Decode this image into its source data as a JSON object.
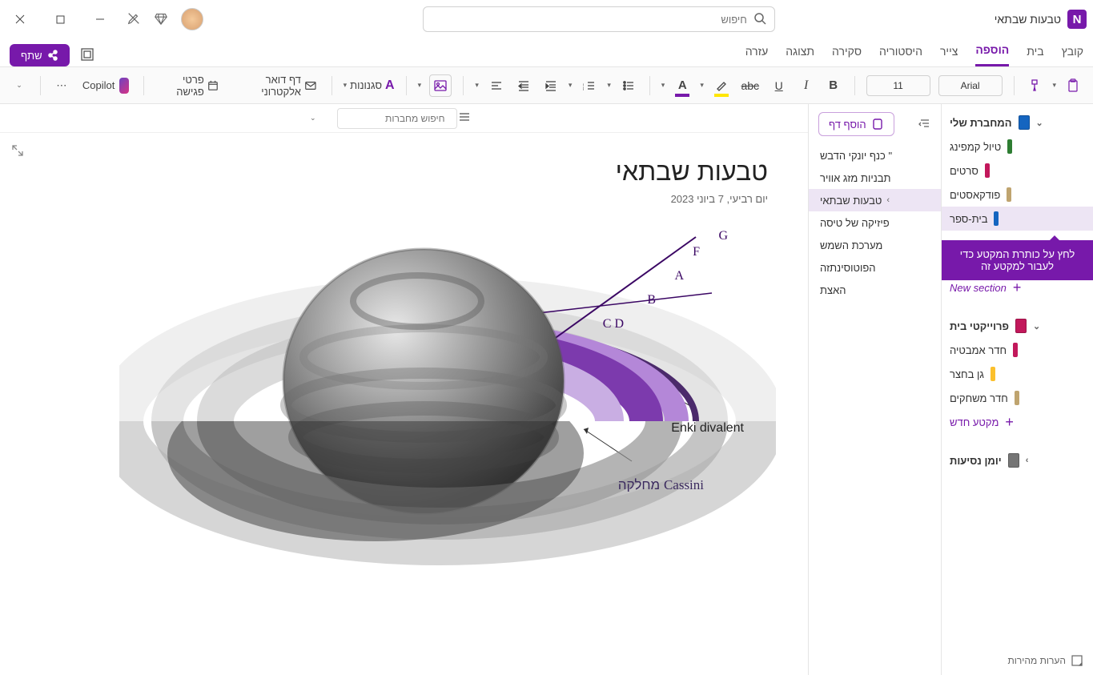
{
  "titlebar": {
    "doc_title": "טבעות שבתאי",
    "search_placeholder": "חיפוש"
  },
  "tabs": {
    "file": "קובץ",
    "home": "בית",
    "insert": "הוספה",
    "draw": "צייר",
    "history": "היסטוריה",
    "review": "סקירה",
    "view": "תצוגה",
    "help": "עזרה",
    "share": "שתף"
  },
  "ribbon": {
    "font_name": "Arial",
    "font_size": "11",
    "styles": "סגנונות",
    "email_page": "דף דואר אלקטרוני",
    "meeting": "פרטי פגישה",
    "copilot": "Copilot"
  },
  "notebooks": {
    "search_placeholder": "חיפוש מחברות",
    "my_notebook": "המחברת שלי",
    "sections1": [
      "טיול קמפינג",
      "סרטים",
      "פודקאסטים",
      "בית-ספר"
    ],
    "new_section": "New section",
    "proj_header": "פרוייקטי בית",
    "sections2": [
      "חדר אמבטיה",
      "גן בחצר",
      "חדר משחקים"
    ],
    "new_section2": "מקטע חדש",
    "travel": "יומן נסיעות",
    "tooltip": "לחץ על כותרת המקטע כדי לעבור למקטע זה",
    "colors": {
      "s1": "#2e7d32",
      "s2": "#c2185b",
      "s3": "#bfa46f",
      "s4": "#1565c0",
      "book1": "#1565c0",
      "book2": "#c2185b",
      "book3": "#757575",
      "p1": "#c2185b",
      "p2": "#fbc02d",
      "p3": "#bfa46f"
    }
  },
  "pages": {
    "add": "הוסף דף",
    "items": [
      "\" כנף יונקי הדבש",
      "תבניות מזג אוויר",
      "טבעות שבתאי",
      "פיזיקה של טיסה",
      "מערכת השמש",
      "הפוטוסינתזה",
      "האצת"
    ],
    "active_index": 2
  },
  "note": {
    "title": "טבעות שבתאי",
    "date": "יום רביעי, 7 ביוני 2023",
    "rings": {
      "g": "G",
      "f": "F",
      "a": "A",
      "b": "B",
      "cd": "C D"
    },
    "label_enki": "Enki divalent",
    "label_cassini_lat": "Cassini",
    "label_cassini_he": "מחלקה"
  },
  "footer": {
    "quick_notes": "הערות מהירות"
  }
}
